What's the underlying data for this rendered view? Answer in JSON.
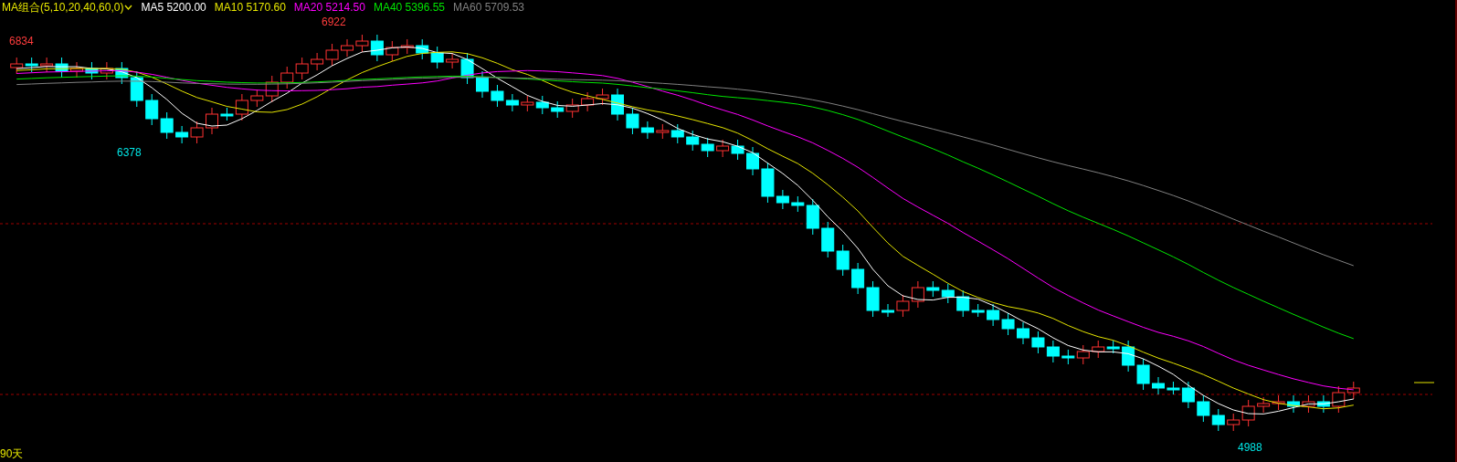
{
  "indicator": {
    "title": "MA组合(5,10,20,40,60,0)"
  },
  "legend": [
    {
      "label": "MA5",
      "value": "5200.00",
      "color": "#ffffff"
    },
    {
      "label": "MA10",
      "value": "5170.60",
      "color": "#e6e600"
    },
    {
      "label": "MA20",
      "value": "5214.50",
      "color": "#ff00ff"
    },
    {
      "label": "MA40",
      "value": "5396.55",
      "color": "#00e600"
    },
    {
      "label": "MA60",
      "value": "5709.53",
      "color": "#808080"
    }
  ],
  "price_labels": [
    {
      "text": "6834",
      "kind": "high"
    },
    {
      "text": "6922",
      "kind": "high"
    },
    {
      "text": "6378",
      "kind": "low"
    },
    {
      "text": "4988",
      "kind": "low"
    }
  ],
  "period": {
    "text": "90天"
  }
}
